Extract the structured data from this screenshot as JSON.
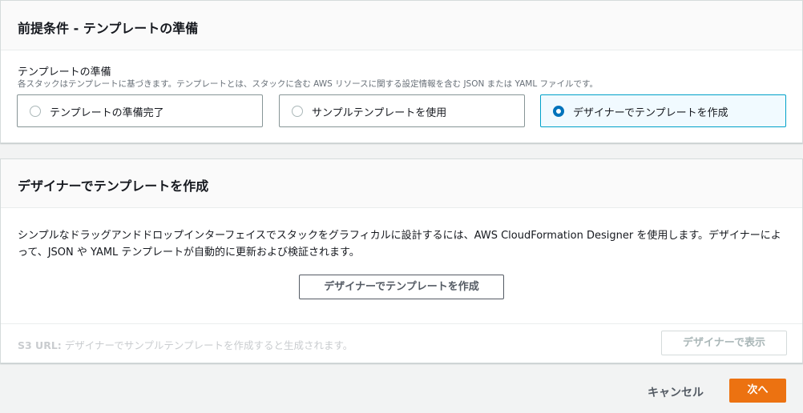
{
  "prerequisite": {
    "title": "前提条件 - テンプレートの準備",
    "field_label": "テンプレートの準備",
    "field_description": "各スタックはテンプレートに基づきます。テンプレートとは、スタックに含む AWS リソースに関する設定情報を含む JSON または YAML ファイルです。",
    "options": [
      {
        "label": "テンプレートの準備完了",
        "selected": false
      },
      {
        "label": "サンプルテンプレートを使用",
        "selected": false
      },
      {
        "label": "デザイナーでテンプレートを作成",
        "selected": true
      }
    ]
  },
  "designer": {
    "title": "デザイナーでテンプレートを作成",
    "description": "シンプルなドラッグアンドドロップインターフェイスでスタックをグラフィカルに設計するには、AWS CloudFormation Designer を使用します。デザイナーによって、JSON や YAML テンプレートが自動的に更新および検証されます。",
    "create_button": "デザイナーでテンプレートを作成",
    "s3_label": "S3 URL:",
    "s3_placeholder": "デザイナーでサンプルテンプレートを作成すると生成されます。",
    "view_button": "デザイナーで表示"
  },
  "footer": {
    "cancel": "キャンセル",
    "next": "次へ"
  },
  "colors": {
    "primary": "#ec7211",
    "selected_border": "#00a1c9",
    "selected_radio": "#0073bb"
  }
}
